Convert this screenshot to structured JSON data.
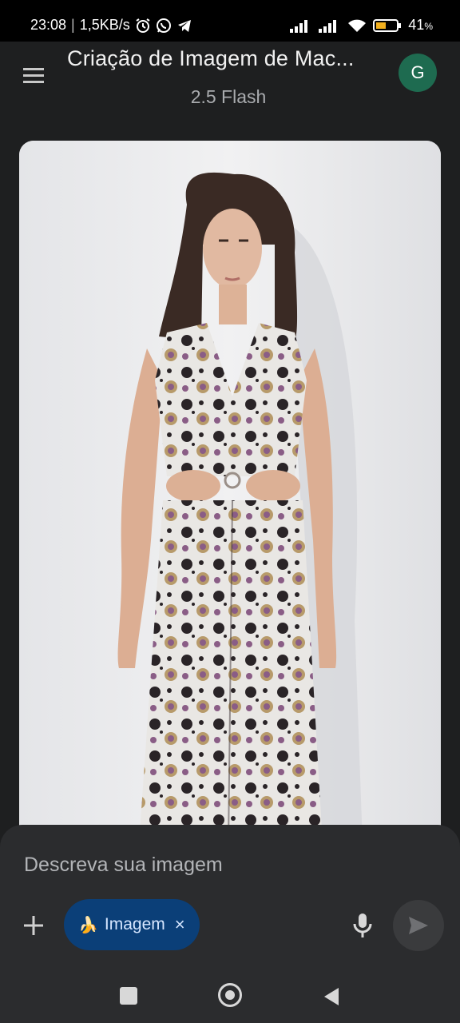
{
  "status_bar": {
    "time": "23:08",
    "speed": "1,5KB/s",
    "battery": "41"
  },
  "header": {
    "title": "Criação de Imagem de Mac...",
    "model": "2.5 Flash",
    "avatar_initial": "G"
  },
  "image": {
    "alt": "Woman in a patterned halter maxi dress"
  },
  "composer": {
    "placeholder": "Descreva sua imagem",
    "chip_emoji": "🍌",
    "chip_label": "Imagem",
    "chip_close": "×"
  },
  "colors": {
    "background": "#1e1f20",
    "composer": "#2b2c2e",
    "chip": "#0b3f78",
    "avatar": "#1e6b50"
  },
  "icons": {
    "menu": "hamburger-icon",
    "plus": "plus-icon",
    "mic": "microphone-icon",
    "send": "send-icon",
    "chip_close": "close-icon"
  }
}
